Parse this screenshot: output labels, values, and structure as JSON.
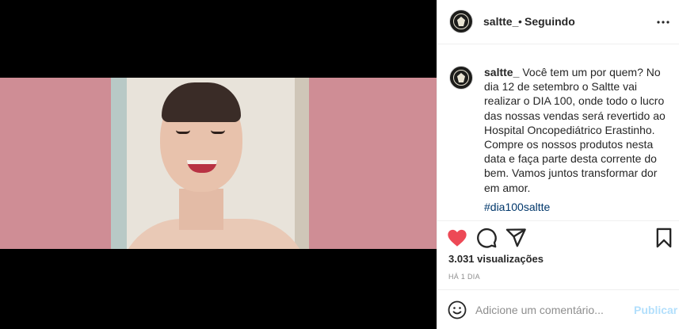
{
  "header": {
    "username": "saltte_",
    "separator": "•",
    "follow_status": "Seguindo",
    "more_icon": "more-horizontal-icon"
  },
  "caption": {
    "username": "saltte_",
    "text": "Você tem um por quem? No dia 12 de setembro o Saltte vai realizar o DIA 100, onde todo o lucro das nossas vendas será revertido ao Hospital Oncopediátrico Erastinho. Compre os nossos produtos nesta data e faça parte desta corrente do bem. Vamos juntos transformar dor em amor.",
    "hashtag": "#dia100saltte"
  },
  "actions": {
    "like_icon": "heart-filled-icon",
    "like_color": "#ed4956",
    "comment_icon": "comment-icon",
    "share_icon": "share-icon",
    "save_icon": "bookmark-icon"
  },
  "stats": {
    "views": "3.031 visualizações",
    "timestamp": "HÁ 1 DIA"
  },
  "comment_box": {
    "emoji_icon": "emoji-icon",
    "placeholder": "Adicione um comentário...",
    "submit_label": "Publicar",
    "submit_color": "#b2dffc"
  },
  "colors": {
    "link": "#00376b",
    "text": "#262626",
    "muted": "#8e8e8e"
  }
}
